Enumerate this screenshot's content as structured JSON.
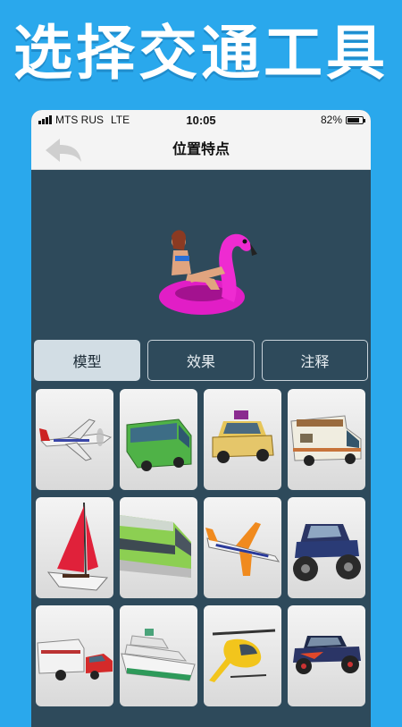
{
  "promo": {
    "title": "选择交通工具"
  },
  "status": {
    "carrier": "MTS RUS",
    "network": "LTE",
    "time": "10:05",
    "battery": "82%",
    "battery_level": 0.82
  },
  "nav": {
    "title": "位置特点",
    "back_icon": "back-arrow-icon"
  },
  "preview": {
    "icon": "flamingo-float-icon"
  },
  "tabs": [
    {
      "label": "模型",
      "active": true
    },
    {
      "label": "效果",
      "active": false
    },
    {
      "label": "注释",
      "active": false
    }
  ],
  "vehicles": [
    {
      "icon": "propeller-plane-icon"
    },
    {
      "icon": "green-bus-icon"
    },
    {
      "icon": "yellow-car-icon"
    },
    {
      "icon": "camper-van-icon"
    },
    {
      "icon": "sailboat-icon"
    },
    {
      "icon": "train-icon"
    },
    {
      "icon": "airliner-icon"
    },
    {
      "icon": "monster-truck-icon"
    },
    {
      "icon": "car-with-trailer-icon"
    },
    {
      "icon": "cruise-ship-icon"
    },
    {
      "icon": "helicopter-icon"
    },
    {
      "icon": "hot-rod-icon"
    }
  ],
  "colors": {
    "background": "#2aa8ec",
    "panel": "#2e4a5b",
    "tab_active": "#d2dde4"
  }
}
